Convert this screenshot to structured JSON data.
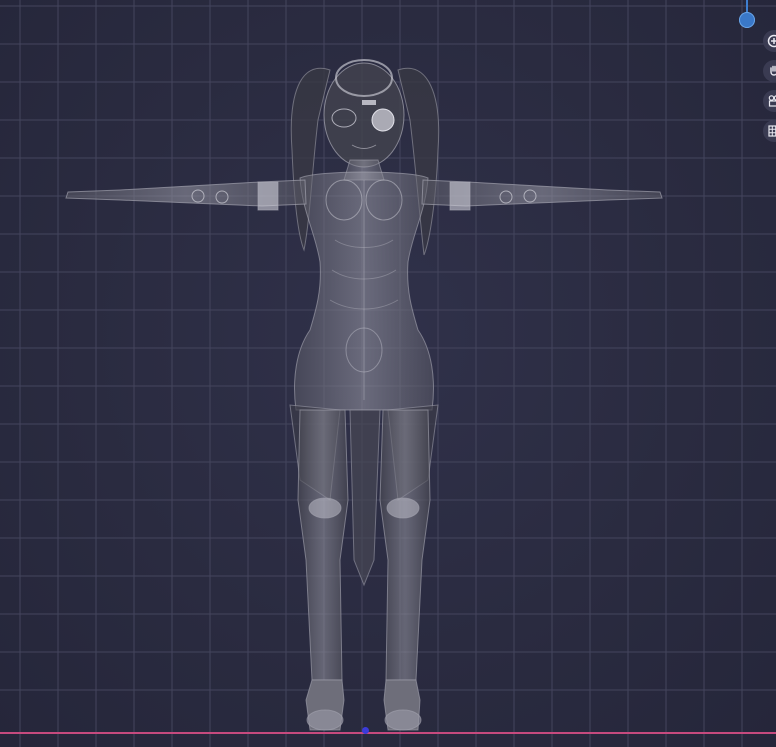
{
  "viewport": {
    "background": "#2a2b40",
    "grid_color": "#4a4b63",
    "x_axis_color": "#c64a7e",
    "z_gizmo_color": "#3a78c8",
    "origin_color": "#3b3bd9"
  },
  "nav_tools": [
    {
      "name": "zoom-icon"
    },
    {
      "name": "pan-hand-icon"
    },
    {
      "name": "camera-icon"
    },
    {
      "name": "grid-view-icon"
    }
  ],
  "model": {
    "pose": "T-pose",
    "style": "x-ray"
  }
}
